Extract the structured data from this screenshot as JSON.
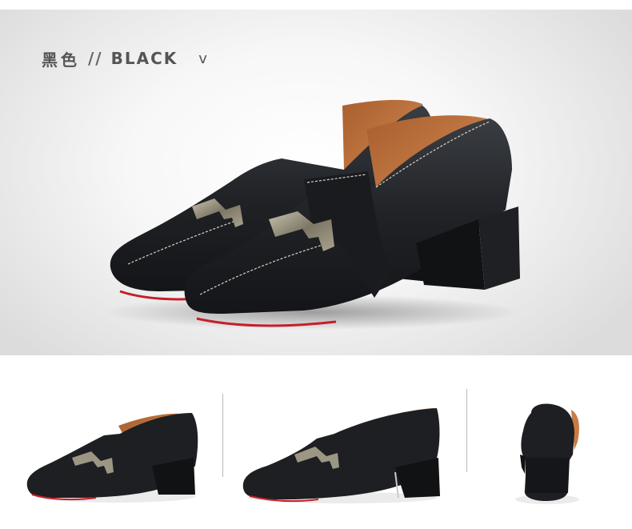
{
  "header": {
    "color_cn": "黑色",
    "separator": "//",
    "color_en": "BLACK",
    "chevron": "v"
  },
  "thumbnails": [
    {
      "view": "three-quarter"
    },
    {
      "view": "side"
    },
    {
      "view": "back"
    }
  ],
  "colors": {
    "leather": "#1c1e21",
    "lining": "#c77c46",
    "sole_accent": "#c41f28",
    "buckle": "#8f8a7a"
  }
}
